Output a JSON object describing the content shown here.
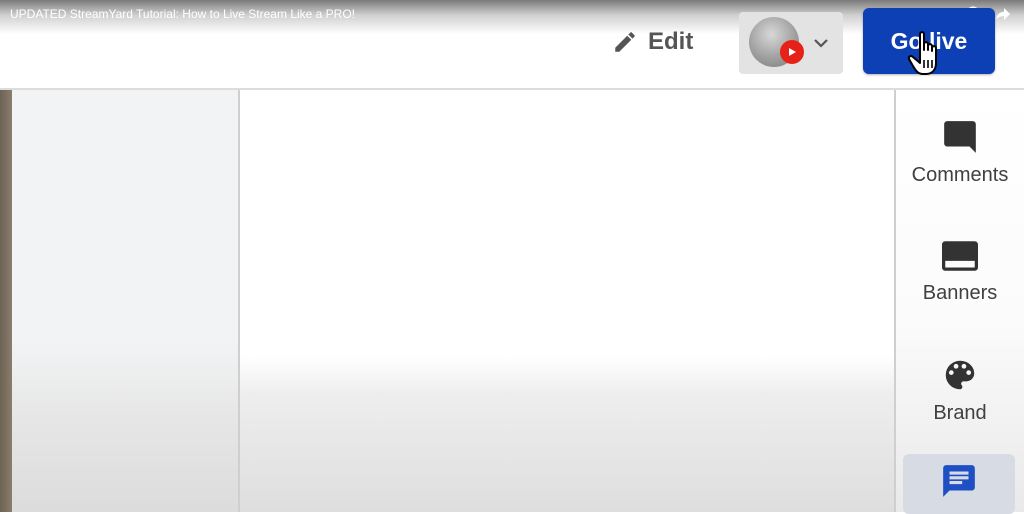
{
  "video_overlay": {
    "title": "UPDATED StreamYard Tutorial: How to Live Stream Like a PRO!",
    "icons": [
      "clock-icon",
      "share-icon"
    ]
  },
  "header": {
    "edit_label": "Edit",
    "destination": {
      "avatar_icon": "avatar",
      "platform_icon": "youtube-icon",
      "chevron_icon": "chevron-down-icon"
    },
    "golive_label": "Go live"
  },
  "sidebar": {
    "items": [
      {
        "label": "Comments",
        "icon": "comment-icon"
      },
      {
        "label": "Banners",
        "icon": "banner-icon"
      },
      {
        "label": "Brand",
        "icon": "palette-icon"
      },
      {
        "label": "",
        "icon": "chat-icon",
        "active": true
      }
    ]
  },
  "colors": {
    "accent": "#0d3fb5",
    "active_item_bg": "#d6dbe4",
    "youtube_red": "#e62117"
  }
}
